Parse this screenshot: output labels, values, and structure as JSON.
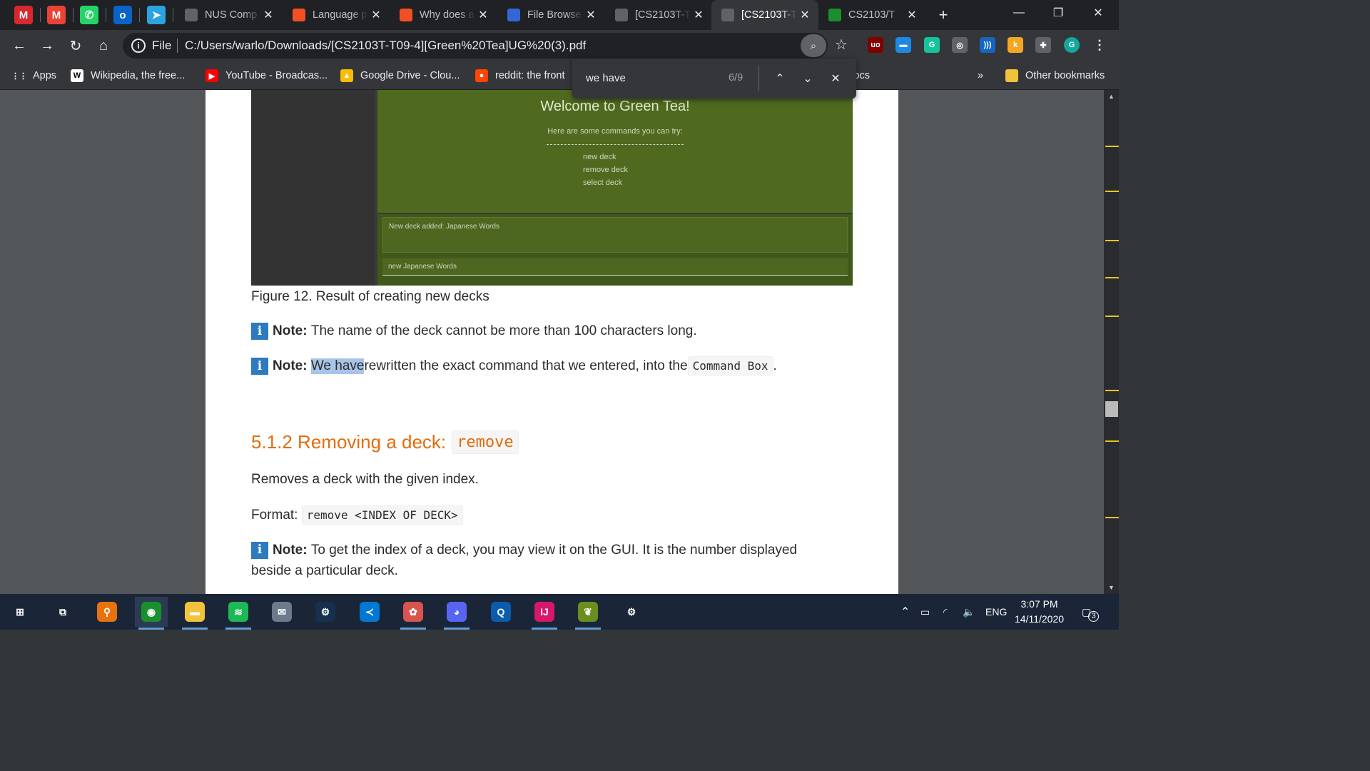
{
  "window": {
    "pinned_tabs": [
      {
        "name": "mega-icon",
        "glyph": "M",
        "color": "#d9272e"
      },
      {
        "name": "gmail-icon",
        "glyph": "M",
        "color": "#ea4335"
      },
      {
        "name": "whatsapp-icon",
        "glyph": "✆",
        "color": "#25d366"
      },
      {
        "name": "outlook-icon",
        "glyph": "o",
        "color": "#0a64c8"
      },
      {
        "name": "telegram-icon",
        "glyph": "➤",
        "color": "#2aa3df"
      }
    ],
    "tabs": [
      {
        "title": "NUS Comp",
        "icon": "shield-icon",
        "color": "#5f6368",
        "active": false
      },
      {
        "title": "Language p",
        "icon": "microsoft-icon",
        "color": "#f25022",
        "active": false
      },
      {
        "title": "Why does a",
        "icon": "microsoft-icon",
        "color": "#f25022",
        "active": false
      },
      {
        "title": "File Browse",
        "icon": "file-browser-icon",
        "color": "#3367d6",
        "active": false
      },
      {
        "title": "[CS2103T-T",
        "icon": "globe-icon",
        "color": "#5f6368",
        "active": false
      },
      {
        "title": "[CS2103T-T",
        "icon": "globe-icon",
        "color": "#5f6368",
        "active": true
      },
      {
        "title": "CS2103/T",
        "icon": "grad-cap-icon",
        "color": "#1a8f2e",
        "active": false
      }
    ],
    "new_tab": "+",
    "controls": {
      "minimize": "—",
      "restore": "❐",
      "close": "✕"
    }
  },
  "toolbar": {
    "scheme": "File",
    "url": "C:/Users/warlo/Downloads/[CS2103T-T09-4][Green%20Tea]UG%20(3).pdf",
    "extensions": [
      {
        "name": "ublock-icon",
        "glyph": "uo",
        "color": "#800000"
      },
      {
        "name": "window-ext-icon",
        "glyph": "▬",
        "color": "#1e88e5"
      },
      {
        "name": "grammarly-icon",
        "glyph": "G",
        "color": "#15c39a"
      },
      {
        "name": "owl-icon",
        "glyph": "◎",
        "color": "#5f6368"
      },
      {
        "name": "wifi-ext-icon",
        "glyph": ")))",
        "color": "#1565c0"
      },
      {
        "name": "k-ext-icon",
        "glyph": "k",
        "color": "#f5a623"
      },
      {
        "name": "puzzle-icon",
        "glyph": "✚",
        "color": "#5f6368"
      },
      {
        "name": "profile-avatar-icon",
        "glyph": "G",
        "color": "#13a89e"
      }
    ]
  },
  "bookmarks": {
    "items": [
      {
        "label": "Apps",
        "glyph": "⋮⋮",
        "color": "#35363a"
      },
      {
        "label": "Wikipedia, the free...",
        "glyph": "W",
        "color": "#ffffff"
      },
      {
        "label": "YouTube - Broadcas...",
        "glyph": "▶",
        "color": "#ff0000"
      },
      {
        "label": "Google Drive - Clou...",
        "glyph": "▲",
        "color": "#fbbc04"
      },
      {
        "label": "reddit: the front",
        "glyph": "●",
        "color": "#ff4500"
      }
    ],
    "docs_label": "Docs",
    "overflow": "»",
    "other": "Other bookmarks"
  },
  "find": {
    "query": "we have",
    "count": "6/9"
  },
  "document": {
    "app": {
      "welcome": "Welcome to Green Tea!",
      "subtitle": "Here are some commands you can try:",
      "commands": [
        "new deck",
        "remove deck",
        "select deck"
      ],
      "result": "New deck added: Japanese Words",
      "input": "new Japanese Words"
    },
    "figure_caption": "Figure 12. Result of creating new decks",
    "note1": {
      "label": "Note:",
      "text": "The name of the deck cannot be more than 100 characters long."
    },
    "note2": {
      "label": "Note:",
      "highlight": "We have",
      "text": " rewritten the exact command that we entered, into the ",
      "code": "Command Box",
      "end": "."
    },
    "section": {
      "title": "5.1.2 Removing a deck:",
      "code": "remove"
    },
    "desc": "Removes a deck with the given index.",
    "format": {
      "label": "Format:",
      "code": "remove <INDEX OF DECK>"
    },
    "note3": {
      "label": "Note:",
      "line1": "To get the index of a deck, you may view it on the GUI. It is the number displayed",
      "line2": "beside a particular deck."
    }
  },
  "taskbar": {
    "apps": [
      {
        "name": "start-icon",
        "glyph": "⊞",
        "color": "#1a2638"
      },
      {
        "name": "task-view-icon",
        "glyph": "⧉",
        "color": "#1a2638"
      },
      {
        "name": "search-icon",
        "glyph": "⚲",
        "color": "#e8730c"
      },
      {
        "name": "chrome-icon",
        "glyph": "◉",
        "color": "#1a8f2e"
      },
      {
        "name": "file-explorer-icon",
        "glyph": "▬",
        "color": "#f3c23c"
      },
      {
        "name": "spotify-icon",
        "glyph": "≋",
        "color": "#1db954"
      },
      {
        "name": "photos-icon",
        "glyph": "✉",
        "color": "#6b7b8c"
      },
      {
        "name": "steam-icon",
        "glyph": "⚙",
        "color": "#16304e"
      },
      {
        "name": "vscode-icon",
        "glyph": "≺",
        "color": "#0078d4"
      },
      {
        "name": "paint-icon",
        "glyph": "✿",
        "color": "#d9534f"
      },
      {
        "name": "discord-icon",
        "glyph": "◕",
        "color": "#5865f2"
      },
      {
        "name": "zoom-like-icon",
        "glyph": "Q",
        "color": "#0b5cad"
      },
      {
        "name": "intellij-icon",
        "glyph": "IJ",
        "color": "#d6186d"
      },
      {
        "name": "sprout-icon",
        "glyph": "❦",
        "color": "#6a8f1f"
      },
      {
        "name": "settings-icon",
        "glyph": "⚙",
        "color": "#1a2638"
      }
    ],
    "language": "ENG",
    "time": "3:07 PM",
    "date": "14/11/2020",
    "notifications": "3"
  }
}
